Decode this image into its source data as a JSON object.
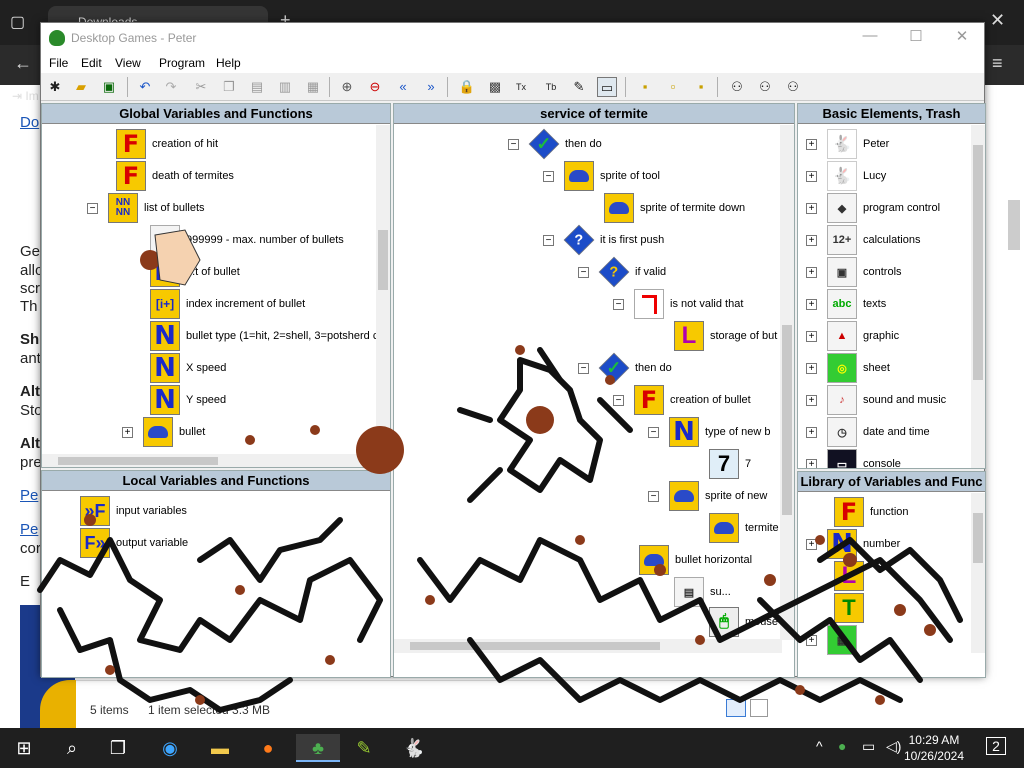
{
  "browser": {
    "tab_title": "Downloads",
    "page_lines": [
      "Do",
      "Ge",
      "allo",
      "scr",
      "Th",
      "Sh",
      "ant",
      "Alt",
      "Sto",
      "Alt",
      "pre",
      "Pe",
      "Pe",
      "cor",
      "E"
    ]
  },
  "explorer_status": {
    "items": "5 items",
    "selected": "1 item selected 3.3 MB"
  },
  "app": {
    "title": "Desktop Games - Peter",
    "menu": [
      "File",
      "Edit",
      "View",
      "Program",
      "Help"
    ]
  },
  "panels": {
    "global": {
      "title": "Global Variables and Functions",
      "rows": [
        {
          "icon": "F",
          "label": "creation of hit"
        },
        {
          "icon": "F",
          "label": "death of termites"
        },
        {
          "icon": "NN",
          "label": "list of bullets"
        },
        {
          "icon": "max",
          "label": "999999 - max. number of bullets"
        },
        {
          "icon": "N",
          "label": "...t of bullet"
        },
        {
          "icon": "idx",
          "label": "index increment of bullet"
        },
        {
          "icon": "N",
          "label": "bullet type (1=hit, 2=shell, 3=potsherd c"
        },
        {
          "icon": "N",
          "label": "X speed"
        },
        {
          "icon": "N",
          "label": "Y speed"
        },
        {
          "icon": "car",
          "label": "bullet"
        }
      ]
    },
    "local": {
      "title": "Local Variables and Functions",
      "rows": [
        {
          "icon": "arrow",
          "label": "input variables"
        },
        {
          "icon": "arrow",
          "label": "output variable"
        }
      ]
    },
    "service": {
      "title": "service of termite",
      "rows": [
        {
          "icon": "check",
          "label": "then do"
        },
        {
          "icon": "car",
          "label": "sprite of tool"
        },
        {
          "icon": "car",
          "label": "sprite of termite down"
        },
        {
          "icon": "q",
          "label": "it is first push"
        },
        {
          "icon": "q2",
          "label": "if valid"
        },
        {
          "icon": "not",
          "label": "is not valid that"
        },
        {
          "icon": "L",
          "label": "storage of but"
        },
        {
          "icon": "check",
          "label": "then do"
        },
        {
          "icon": "F",
          "label": "creation of bullet"
        },
        {
          "icon": "N",
          "label": "type of new b"
        },
        {
          "icon": "seven",
          "label": "7"
        },
        {
          "icon": "car",
          "label": "sprite of new"
        },
        {
          "icon": "car",
          "label": "termite"
        },
        {
          "icon": "car",
          "label": "bullet horizontal"
        },
        {
          "icon": "misc",
          "label": "su..."
        },
        {
          "icon": "mouse",
          "label": "mouse"
        }
      ]
    },
    "basic": {
      "title": "Basic Elements, Trash",
      "rows": [
        {
          "icon": "rabbit",
          "label": "Peter"
        },
        {
          "icon": "rabbit",
          "label": "Lucy"
        },
        {
          "icon": "misc",
          "label": "program control"
        },
        {
          "icon": "misc",
          "label": "calculations"
        },
        {
          "icon": "misc",
          "label": "controls"
        },
        {
          "icon": "misc",
          "label": "texts"
        },
        {
          "icon": "misc",
          "label": "graphic"
        },
        {
          "icon": "misc",
          "label": "sheet"
        },
        {
          "icon": "misc",
          "label": "sound and music"
        },
        {
          "icon": "misc",
          "label": "date and time"
        },
        {
          "icon": "misc",
          "label": "console"
        }
      ]
    },
    "library": {
      "title": "Library of Variables and Func",
      "rows": [
        {
          "icon": "F",
          "label": "function"
        },
        {
          "icon": "N",
          "label": "number"
        },
        {
          "icon": "L",
          "label": ""
        },
        {
          "icon": "T",
          "label": ""
        },
        {
          "icon": "misc",
          "label": ""
        }
      ]
    }
  },
  "taskbar": {
    "time": "10:29 AM",
    "date": "10/26/2024",
    "notifications": "2"
  }
}
